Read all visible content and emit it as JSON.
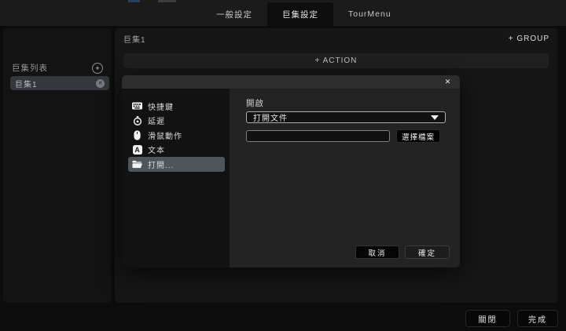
{
  "topbar": {
    "tabs": [
      {
        "label": "一般設定",
        "active": false
      },
      {
        "label": "巨集設定",
        "active": true
      },
      {
        "label": "TourMenu",
        "active": false
      }
    ]
  },
  "sidebar": {
    "title": "巨集列表",
    "add_glyph": "+",
    "items": [
      {
        "label": "巨集1",
        "remove_glyph": "✕"
      }
    ]
  },
  "main": {
    "title": "巨集1",
    "group_button": "+ GROUP",
    "action_button": "+ ACTION"
  },
  "dialog": {
    "close_glyph": "✕",
    "menu": [
      {
        "label": "快捷鍵",
        "icon": "keyboard-icon",
        "selected": false
      },
      {
        "label": "延遲",
        "icon": "timer-icon",
        "selected": false
      },
      {
        "label": "滑鼠動作",
        "icon": "mouse-icon",
        "selected": false
      },
      {
        "label": "文本",
        "icon": "text-icon",
        "selected": false
      },
      {
        "label": "打開...",
        "icon": "folder-icon",
        "selected": true
      }
    ],
    "form": {
      "label": "開啟",
      "dropdown_value": "打開文件",
      "file_path_value": "",
      "choose_file_button": "選擇檔案"
    },
    "cancel_button": "取消",
    "ok_button": "確定"
  },
  "footer": {
    "close_button": "關閉",
    "done_button": "完成"
  },
  "colors": {
    "topbar_bg": "#1b1b1c",
    "active_tab_bg": "#0e0e0f",
    "panel_bg": "#161617",
    "sidebar_bg": "#131314",
    "dialog_titlebar_bg": "#2d2d2e",
    "dialog_menu_bg": "#121213",
    "dialog_form_bg": "#232324",
    "selected_menu_item_bg": "#4e565c",
    "macro_item_bg": "#34383c"
  }
}
